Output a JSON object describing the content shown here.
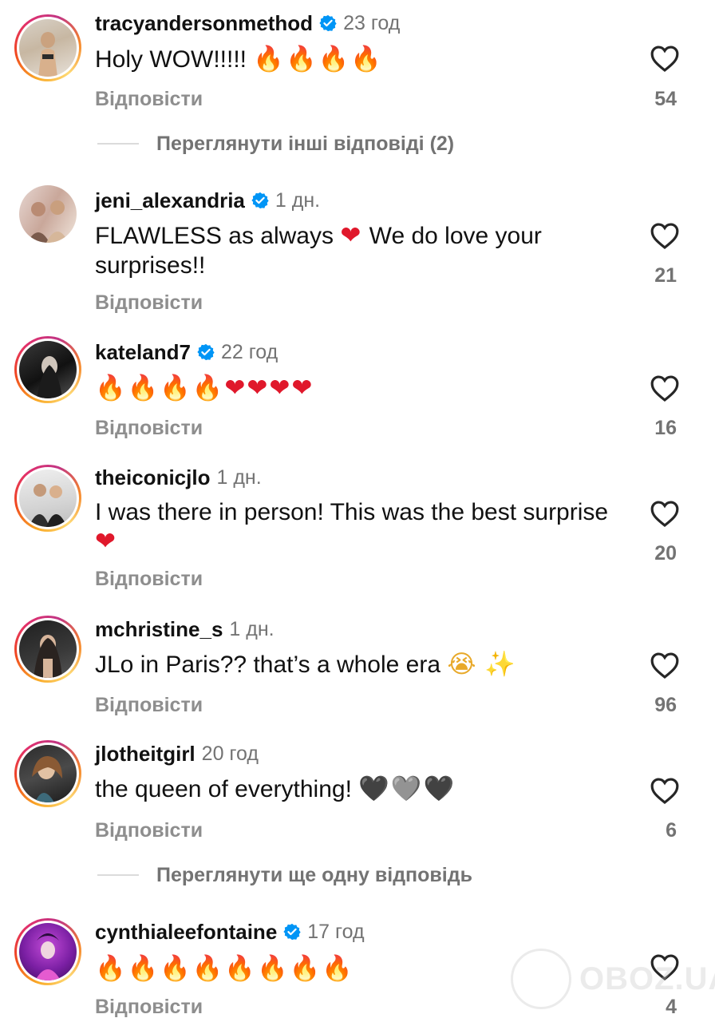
{
  "comments": [
    {
      "username": "tracyandersonmethod",
      "verified": true,
      "time": "23 год",
      "text": "Holy WOW!!!!!",
      "emoji": "🔥🔥🔥🔥",
      "reply_label": "Відповісти",
      "likes": "54"
    },
    {
      "username": "jeni_alexandria",
      "verified": true,
      "time": "1 дн.",
      "text": "FLAWLESS as always",
      "emoji": "❤",
      "text_after": "We do love your surprises!!",
      "reply_label": "Відповісти",
      "likes": "21"
    },
    {
      "username": "kateland7",
      "verified": true,
      "time": "22 год",
      "text": "",
      "emoji": "🔥🔥🔥🔥",
      "emoji2": "❤❤❤❤",
      "reply_label": "Відповісти",
      "likes": "16"
    },
    {
      "username": "theiconicjlo",
      "verified": false,
      "time": "1 дн.",
      "text": "I was there in person! This was the best surprise",
      "emoji": "❤",
      "reply_label": "Відповісти",
      "likes": "20"
    },
    {
      "username": "mchristine_s",
      "verified": false,
      "time": "1 дн.",
      "text": "JLo in Paris?? that’s a whole era",
      "emoji": "😭",
      "emoji2": "✨",
      "reply_label": "Відповісти",
      "likes": "96"
    },
    {
      "username": "jlotheitgirl",
      "verified": false,
      "time": "20 год",
      "text": "the queen of everything!",
      "emoji": "🖤",
      "emoji2": "🩶",
      "emoji3": "🖤",
      "reply_label": "Відповісти",
      "likes": "6"
    },
    {
      "username": "cynthialeefontaine",
      "verified": true,
      "time": "17 год",
      "text": "",
      "emoji": "🔥🔥🔥🔥🔥🔥🔥🔥",
      "reply_label": "Відповісти",
      "likes": "4"
    }
  ],
  "more_replies": [
    {
      "label": "Переглянути інші відповіді (2)"
    },
    {
      "label": "Переглянути ще одну відповідь"
    }
  ],
  "watermark": {
    "text": "OBOZ.UA"
  },
  "colors": {
    "verified": "#0095f6",
    "muted": "#737373",
    "ring_start": "#f9a826",
    "ring_end": "#c13584"
  }
}
